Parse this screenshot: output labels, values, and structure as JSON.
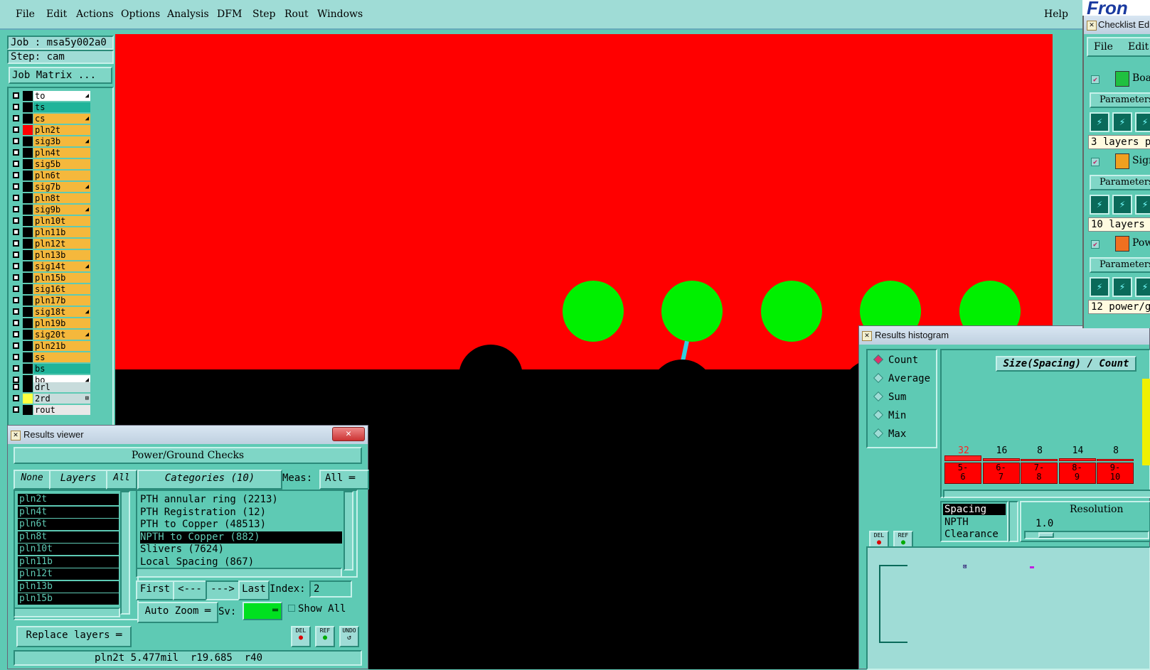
{
  "menubar": {
    "items": [
      "File",
      "Edit",
      "Actions",
      "Options",
      "Analysis",
      "DFM",
      "Step",
      "Rout",
      "Windows"
    ],
    "help": "Help"
  },
  "job": {
    "job_label": "Job : msa5y002a0",
    "step_label": "Step: cam",
    "matrix_button": "Job Matrix ..."
  },
  "layers": [
    {
      "name": "to",
      "bg": "#ffffff",
      "arrow": true,
      "swatch": "#000000"
    },
    {
      "name": "ts",
      "bg": "#20b49a",
      "arrow": false,
      "swatch": "#000000"
    },
    {
      "name": "cs",
      "bg": "#f5b83c",
      "arrow": true,
      "swatch": "#000000"
    },
    {
      "name": "pln2t",
      "bg": "#f5b83c",
      "arrow": false,
      "swatch": "#ff0000"
    },
    {
      "name": "sig3b",
      "bg": "#f5b83c",
      "arrow": true,
      "swatch": "#000000"
    },
    {
      "name": "pln4t",
      "bg": "#f5b83c",
      "arrow": false,
      "swatch": "#000000"
    },
    {
      "name": "sig5b",
      "bg": "#f5b83c",
      "arrow": false,
      "swatch": "#000000"
    },
    {
      "name": "pln6t",
      "bg": "#f5b83c",
      "arrow": false,
      "swatch": "#000000"
    },
    {
      "name": "sig7b",
      "bg": "#f5b83c",
      "arrow": true,
      "swatch": "#000000"
    },
    {
      "name": "pln8t",
      "bg": "#f5b83c",
      "arrow": false,
      "swatch": "#000000"
    },
    {
      "name": "sig9b",
      "bg": "#f5b83c",
      "arrow": true,
      "swatch": "#000000"
    },
    {
      "name": "pln10t",
      "bg": "#f5b83c",
      "arrow": false,
      "swatch": "#000000"
    },
    {
      "name": "pln11b",
      "bg": "#f5b83c",
      "arrow": false,
      "swatch": "#000000"
    },
    {
      "name": "pln12t",
      "bg": "#f5b83c",
      "arrow": false,
      "swatch": "#000000"
    },
    {
      "name": "pln13b",
      "bg": "#f5b83c",
      "arrow": false,
      "swatch": "#000000"
    },
    {
      "name": "sig14t",
      "bg": "#f5b83c",
      "arrow": true,
      "swatch": "#000000"
    },
    {
      "name": "pln15b",
      "bg": "#f5b83c",
      "arrow": false,
      "swatch": "#000000"
    },
    {
      "name": "sig16t",
      "bg": "#f5b83c",
      "arrow": false,
      "swatch": "#000000"
    },
    {
      "name": "pln17b",
      "bg": "#f5b83c",
      "arrow": false,
      "swatch": "#000000"
    },
    {
      "name": "sig18t",
      "bg": "#f5b83c",
      "arrow": true,
      "swatch": "#000000"
    },
    {
      "name": "pln19b",
      "bg": "#f5b83c",
      "arrow": false,
      "swatch": "#000000"
    },
    {
      "name": "sig20t",
      "bg": "#f5b83c",
      "arrow": true,
      "swatch": "#000000"
    },
    {
      "name": "pln21b",
      "bg": "#f5b83c",
      "arrow": false,
      "swatch": "#000000"
    },
    {
      "name": "ss",
      "bg": "#f5b83c",
      "arrow": false,
      "swatch": "#000000"
    },
    {
      "name": "bs",
      "bg": "#20b49a",
      "arrow": false,
      "swatch": "#000000"
    },
    {
      "name": "bo",
      "bg": "#ffffff",
      "arrow": true,
      "swatch": "#000000"
    }
  ],
  "drill_layers": [
    {
      "name": "drl",
      "bg": "#c8dcdc",
      "swatch": "#000000",
      "arrow": ""
    },
    {
      "name": "2rd",
      "bg": "#c8dcdc",
      "swatch": "#ffff40",
      "arrow": "⊞"
    },
    {
      "name": "rout",
      "bg": "#e8e8e8",
      "swatch": "#000000",
      "arrow": ""
    }
  ],
  "results_viewer": {
    "title": "Results viewer",
    "header": "Power/Ground Checks",
    "btn_none": "None",
    "btn_layers": "Layers",
    "btn_all": "All",
    "categories_button": "Categories (10)",
    "meas_label": "Meas:",
    "meas_value": "All",
    "layer_list": [
      "pln2t",
      "pln4t",
      "pln6t",
      "pln8t",
      "pln10t",
      "pln11b",
      "pln12t",
      "pln13b",
      "pln15b"
    ],
    "categories": [
      "PTH annular ring (2213)",
      "PTH Registration (12)",
      "PTH to Copper (48513)",
      "NPTH to Copper (882)",
      "Slivers (7624)",
      "Local Spacing (867)"
    ],
    "selected_category_index": 3,
    "first": "First",
    "prev": "<---",
    "next": "--->",
    "last": "Last",
    "index_label": "Index:",
    "index_value": "2",
    "auto_zoom": "Auto Zoom",
    "sv_label": "Sv:",
    "show_all": "Show All",
    "replace_layers": "Replace layers",
    "status": "pln2t 5.477mil  r19.685  r40",
    "del": "DEL",
    "ref": "REF",
    "undo": "UNDO"
  },
  "histogram": {
    "title": "Results histogram",
    "modes": [
      "Count",
      "Average",
      "Sum",
      "Min",
      "Max"
    ],
    "selected_mode": "Count",
    "chart_title": "Size(Spacing) / Count",
    "bars": [
      {
        "label": "5-\n6",
        "count": "32",
        "color": "#ff2020"
      },
      {
        "label": "6-\n7",
        "count": "16",
        "color": "#000"
      },
      {
        "label": "7-\n8",
        "count": "8",
        "color": "#000"
      },
      {
        "label": "8-\n9",
        "count": "14",
        "color": "#000"
      },
      {
        "label": "9-\n10",
        "count": "8",
        "color": "#000"
      }
    ],
    "type_list": [
      "Spacing",
      "NPTH",
      "Clearance"
    ],
    "resolution_label": "Resolution",
    "resolution_value": "1.0",
    "del": "DEL",
    "ref": "REF"
  },
  "checklist": {
    "title": "Checklist Ed",
    "menu": [
      "File",
      "Edit"
    ],
    "items": [
      {
        "name": "Boa",
        "params": "Parameters",
        "summary": "3 layers p"
      },
      {
        "name": "Sign",
        "params": "Parameters",
        "summary": "10 layers"
      },
      {
        "name": "Pow",
        "params": "Parameters",
        "summary": "12 power/g"
      }
    ]
  },
  "logo_text": "Fron",
  "colors": {
    "panel": "#5ecab4",
    "canvas_bg": "#ff0000",
    "pad": "#00f000",
    "layer_active": "#f5b83c"
  }
}
